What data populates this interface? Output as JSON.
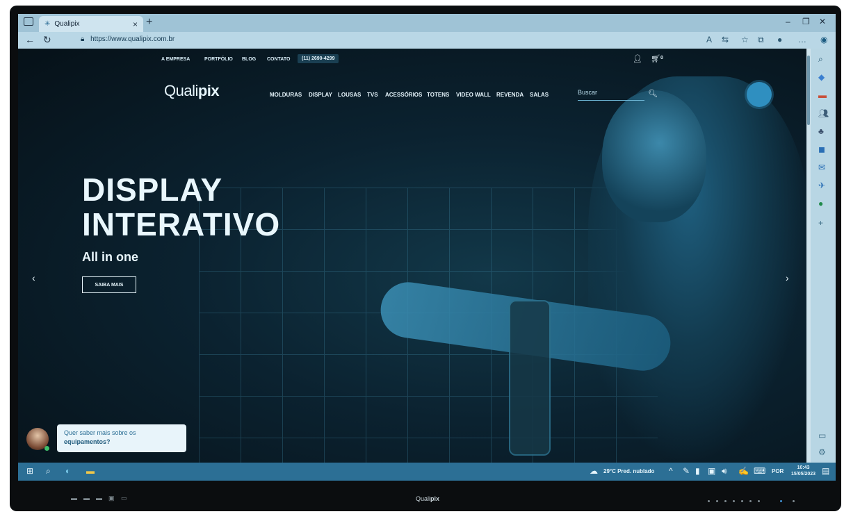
{
  "browser": {
    "tab_title": "Qualipix",
    "url": "https://www.qualipix.com.br",
    "new_tab": "+",
    "close_tab": "×"
  },
  "site": {
    "topnav": [
      "A EMPRESA",
      "PORTFÓLIO",
      "BLOG",
      "CONTATO"
    ],
    "phone": "(11) 2690-4299",
    "cart_count": "0",
    "logo_light": "Quali",
    "logo_bold": "pix",
    "mainnav": [
      "MOLDURAS",
      "DISPLAY",
      "LOUSAS",
      "TVS",
      "ACESSÓRIOS",
      "TOTENS",
      "VIDEO WALL",
      "REVENDA",
      "SALAS"
    ],
    "search_placeholder": "Buscar",
    "hero_line1": "DISPLAY",
    "hero_line2": "INTERATIVO",
    "hero_sub": "All in one",
    "cta_label": "SAIBA MAIS",
    "chat_line1": "Quer saber mais sobre os",
    "chat_line2": "equipamentos?"
  },
  "taskbar": {
    "weather": "29°C Pred. nublado",
    "language": "POR",
    "time": "10:43",
    "date": "15/05/2023"
  },
  "bezel": {
    "brand_light": "Quali",
    "brand_bold": "pix"
  }
}
